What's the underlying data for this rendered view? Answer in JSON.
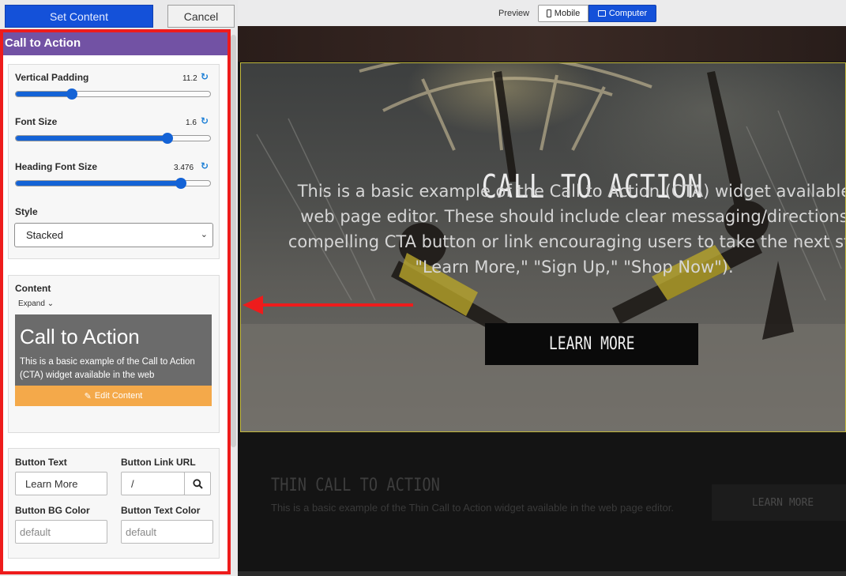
{
  "toolbar": {
    "set_content": "Set Content",
    "cancel": "Cancel",
    "preview_label": "Preview",
    "mode_mobile": "Mobile",
    "mode_computer": "Computer",
    "active_mode": "Computer"
  },
  "panel": {
    "title": "Call to Action",
    "vertical_padding": {
      "label": "Vertical Padding",
      "value": "11.2",
      "level": 0.29
    },
    "font_size": {
      "label": "Font Size",
      "value": "1.6",
      "level": 0.78
    },
    "heading_font_size": {
      "label": "Heading Font Size",
      "value": "3.476",
      "level": 0.85
    },
    "style": {
      "label": "Style",
      "selected": "Stacked"
    },
    "content": {
      "label": "Content",
      "expand": "Expand",
      "preview_title": "Call to Action",
      "preview_text": "This is a basic example of the Call to Action (CTA) widget available in the web",
      "edit_button": "Edit Content"
    },
    "button_text": {
      "label": "Button Text",
      "value": "Learn More"
    },
    "button_link_url": {
      "label": "Button Link URL",
      "value": "/"
    },
    "button_bg_color": {
      "label": "Button BG Color",
      "placeholder": "default"
    },
    "button_text_color": {
      "label": "Button Text Color",
      "placeholder": "default"
    }
  },
  "canvas": {
    "hero": {
      "title": "CALL TO ACTION",
      "body_lines": [
        "This is a basic example of the Call to Action (CTA) widget available",
        "web page editor. These should include clear messaging/directions",
        "compelling CTA button or link encouraging users to take the next ste",
        "\"Learn More,\" \"Sign Up,\" \"Shop Now\")."
      ],
      "button": "LEARN MORE"
    },
    "thin": {
      "title": "THIN CALL TO ACTION",
      "text": "This is a basic example of the Thin Call to Action widget available in the web page editor.",
      "button": "LEARN MORE"
    }
  },
  "colors": {
    "accent_blue": "#1451d9",
    "panel_header": "#7252a4",
    "highlight_border": "#ee1c1c",
    "edit_button": "#f4a94a",
    "hero_border": "#c3b83c"
  }
}
